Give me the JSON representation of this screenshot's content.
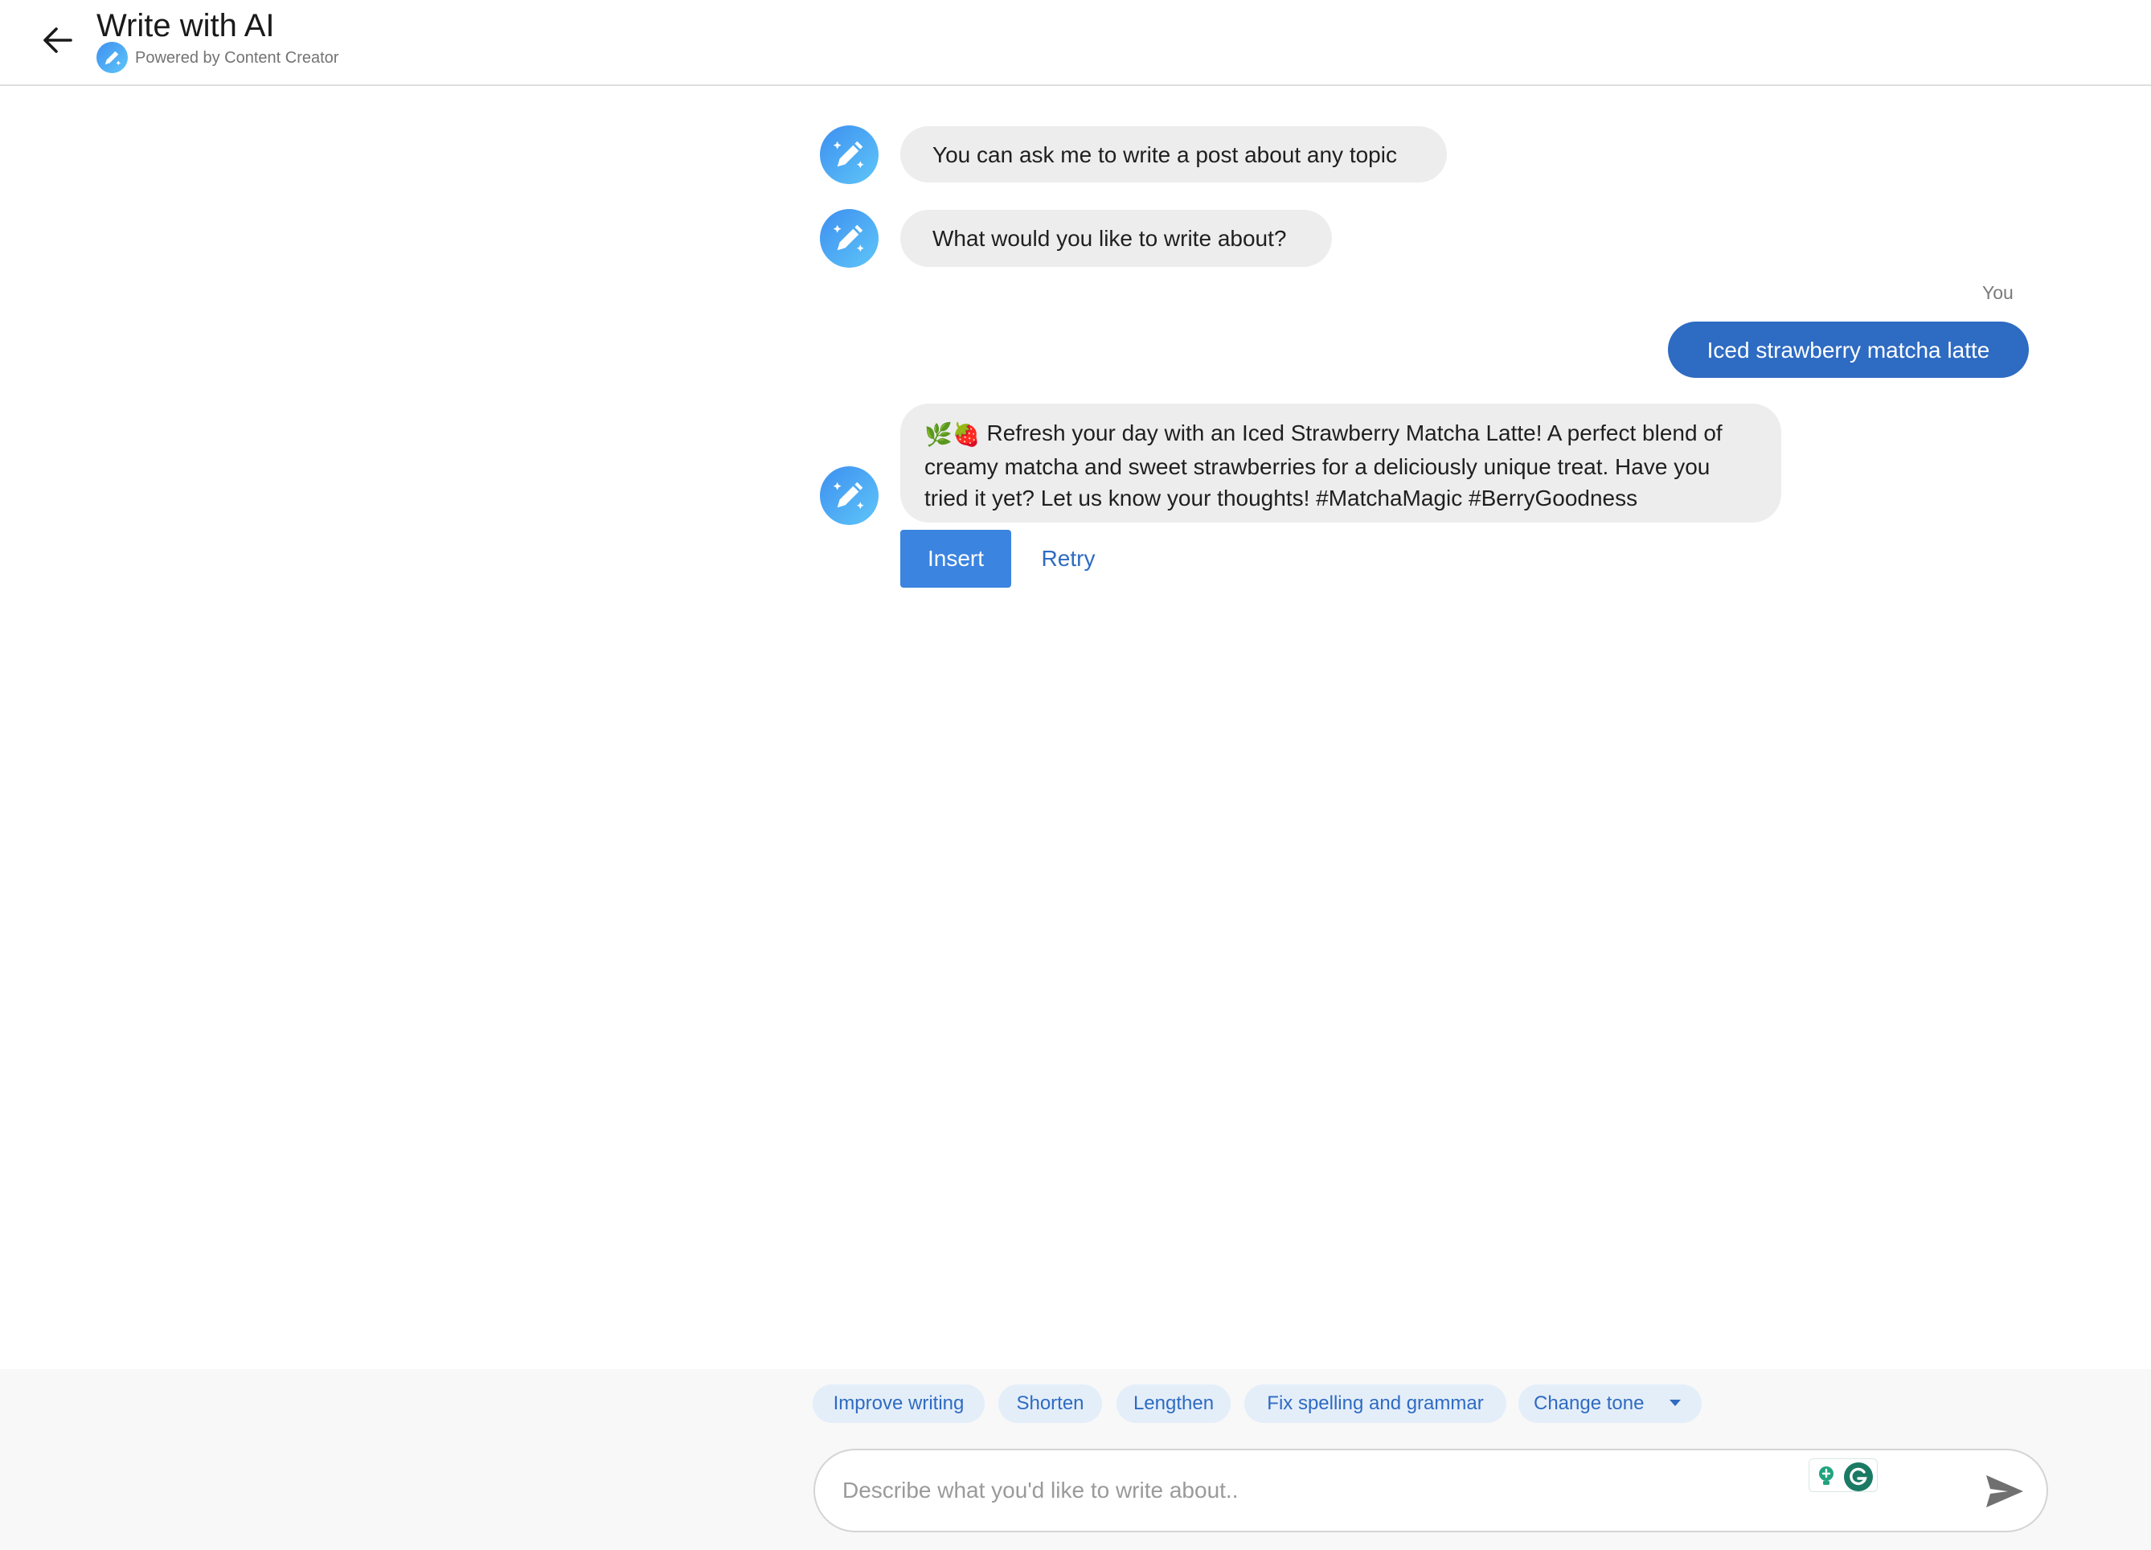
{
  "header": {
    "title": "Write with AI",
    "powered_by": "Powered by Content Creator"
  },
  "chat": {
    "messages": [
      {
        "sender": "assistant",
        "text": "You can ask me to write a post about any topic"
      },
      {
        "sender": "assistant",
        "text": "What would you like to write about?"
      },
      {
        "sender": "user",
        "sender_label": "You",
        "text": "Iced strawberry matcha latte"
      },
      {
        "sender": "assistant",
        "emoji": "🌿🍓",
        "text": "Refresh your day with an Iced Strawberry Matcha Latte! A perfect blend of\ncreamy matcha and sweet strawberries for a deliciously unique treat. Have you\ntried it yet? Let us know your thoughts! #MatchaMagic #BerryGoodness"
      }
    ],
    "actions": {
      "insert_label": "Insert",
      "retry_label": "Retry"
    }
  },
  "suggestions": {
    "chips": [
      "Improve writing",
      "Shorten",
      "Lengthen",
      "Fix spelling and grammar"
    ],
    "tone_label": "Change tone"
  },
  "composer": {
    "placeholder": "Describe what you'd like to write about..",
    "value": ""
  },
  "icons": {
    "back": "arrow-left-icon",
    "assistant_avatar": "magic-pencil-icon",
    "send": "send-icon",
    "extension": "grammarly-icon"
  },
  "colors": {
    "accent": "#3b84e0",
    "user_bubble": "#2e6bc2",
    "ai_bubble": "#ededed",
    "chip_bg": "#e4eef9",
    "chip_text": "#2e6bc2"
  }
}
